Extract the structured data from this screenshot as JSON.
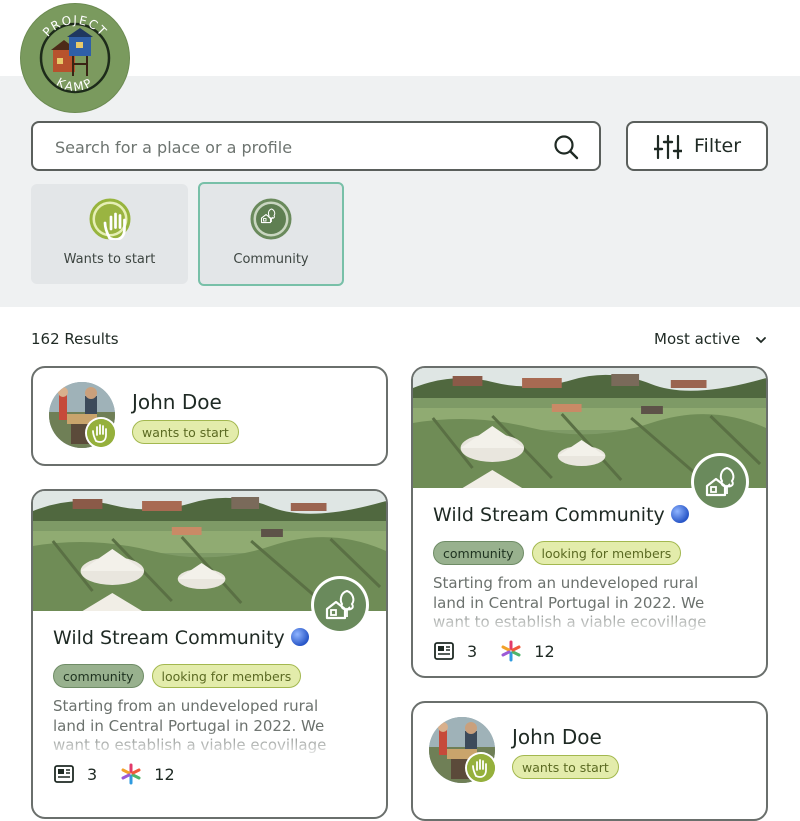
{
  "logo": {
    "text_top": "PROJECT",
    "text_bottom": "KAMP"
  },
  "search": {
    "placeholder": "Search for a place or a profile"
  },
  "filter_button": {
    "label": "Filter"
  },
  "categories": [
    {
      "label": "Wants to start",
      "icon": "raised-hand-icon"
    },
    {
      "label": "Community",
      "icon": "home-tree-icon"
    }
  ],
  "results": {
    "count_label": "162 Results",
    "sort_label": "Most active"
  },
  "profiles": [
    {
      "name": "John Doe",
      "tag": "wants to start"
    },
    {
      "name": "John Doe",
      "tag": "wants to start"
    }
  ],
  "communities": [
    {
      "title": "Wild Stream Community",
      "tags": [
        "community",
        "looking for members"
      ],
      "description": "Starting from an undeveloped rural land in Central Portugal in 2022. We want to establish a viable ecovillage project with a",
      "posts": "3",
      "members": "12"
    },
    {
      "title": "Wild Stream Community",
      "tags": [
        "community",
        "looking for members"
      ],
      "description": "Starting from an undeveloped rural land in Central Portugal in 2022. We want to establish a viable ecovillage project with a",
      "posts": "3",
      "members": "12"
    }
  ],
  "colors": {
    "accent_green": "#6a8a5c",
    "tag_yellow": "#e3ecab",
    "tag_green": "#98b18e",
    "selected_border": "#78c0a8",
    "panel_bg": "#eff1f2"
  }
}
